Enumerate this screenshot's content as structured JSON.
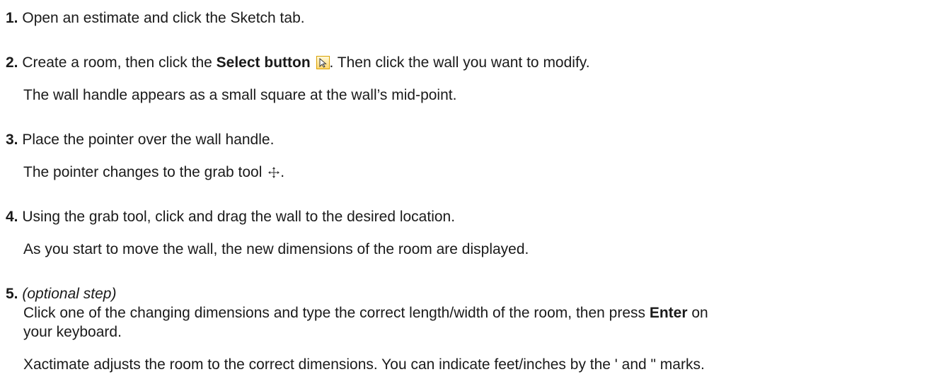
{
  "steps": [
    {
      "number": "1.",
      "text": "Open an estimate and click the Sketch tab."
    },
    {
      "number": "2.",
      "text_before": "Create a room, then click the ",
      "bold": "Select button",
      "text_after": ". Then click the wall you want to modify.",
      "note": "The wall handle appears as a small square at the wall’s mid-point.",
      "icon": "select-arrow-icon"
    },
    {
      "number": "3.",
      "text": "Place the pointer over the wall handle.",
      "note_before": "The pointer changes to the grab tool ",
      "note_after": ".",
      "icon": "grab-tool-icon"
    },
    {
      "number": "4.",
      "text": "Using the grab tool, click and drag the wall to the desired location.",
      "note": "As you start to move the wall, the new dimensions of the room are displayed."
    },
    {
      "number": "5.",
      "italic": "(optional step)",
      "text_before": "Click one of the changing dimensions and type the correct length/width of the room, then press ",
      "bold": "Enter",
      "text_after": " on",
      "text_line2": "your keyboard.",
      "note": "Xactimate adjusts the room to the correct dimensions. You can indicate feet/inches by the ' and \" marks."
    }
  ]
}
